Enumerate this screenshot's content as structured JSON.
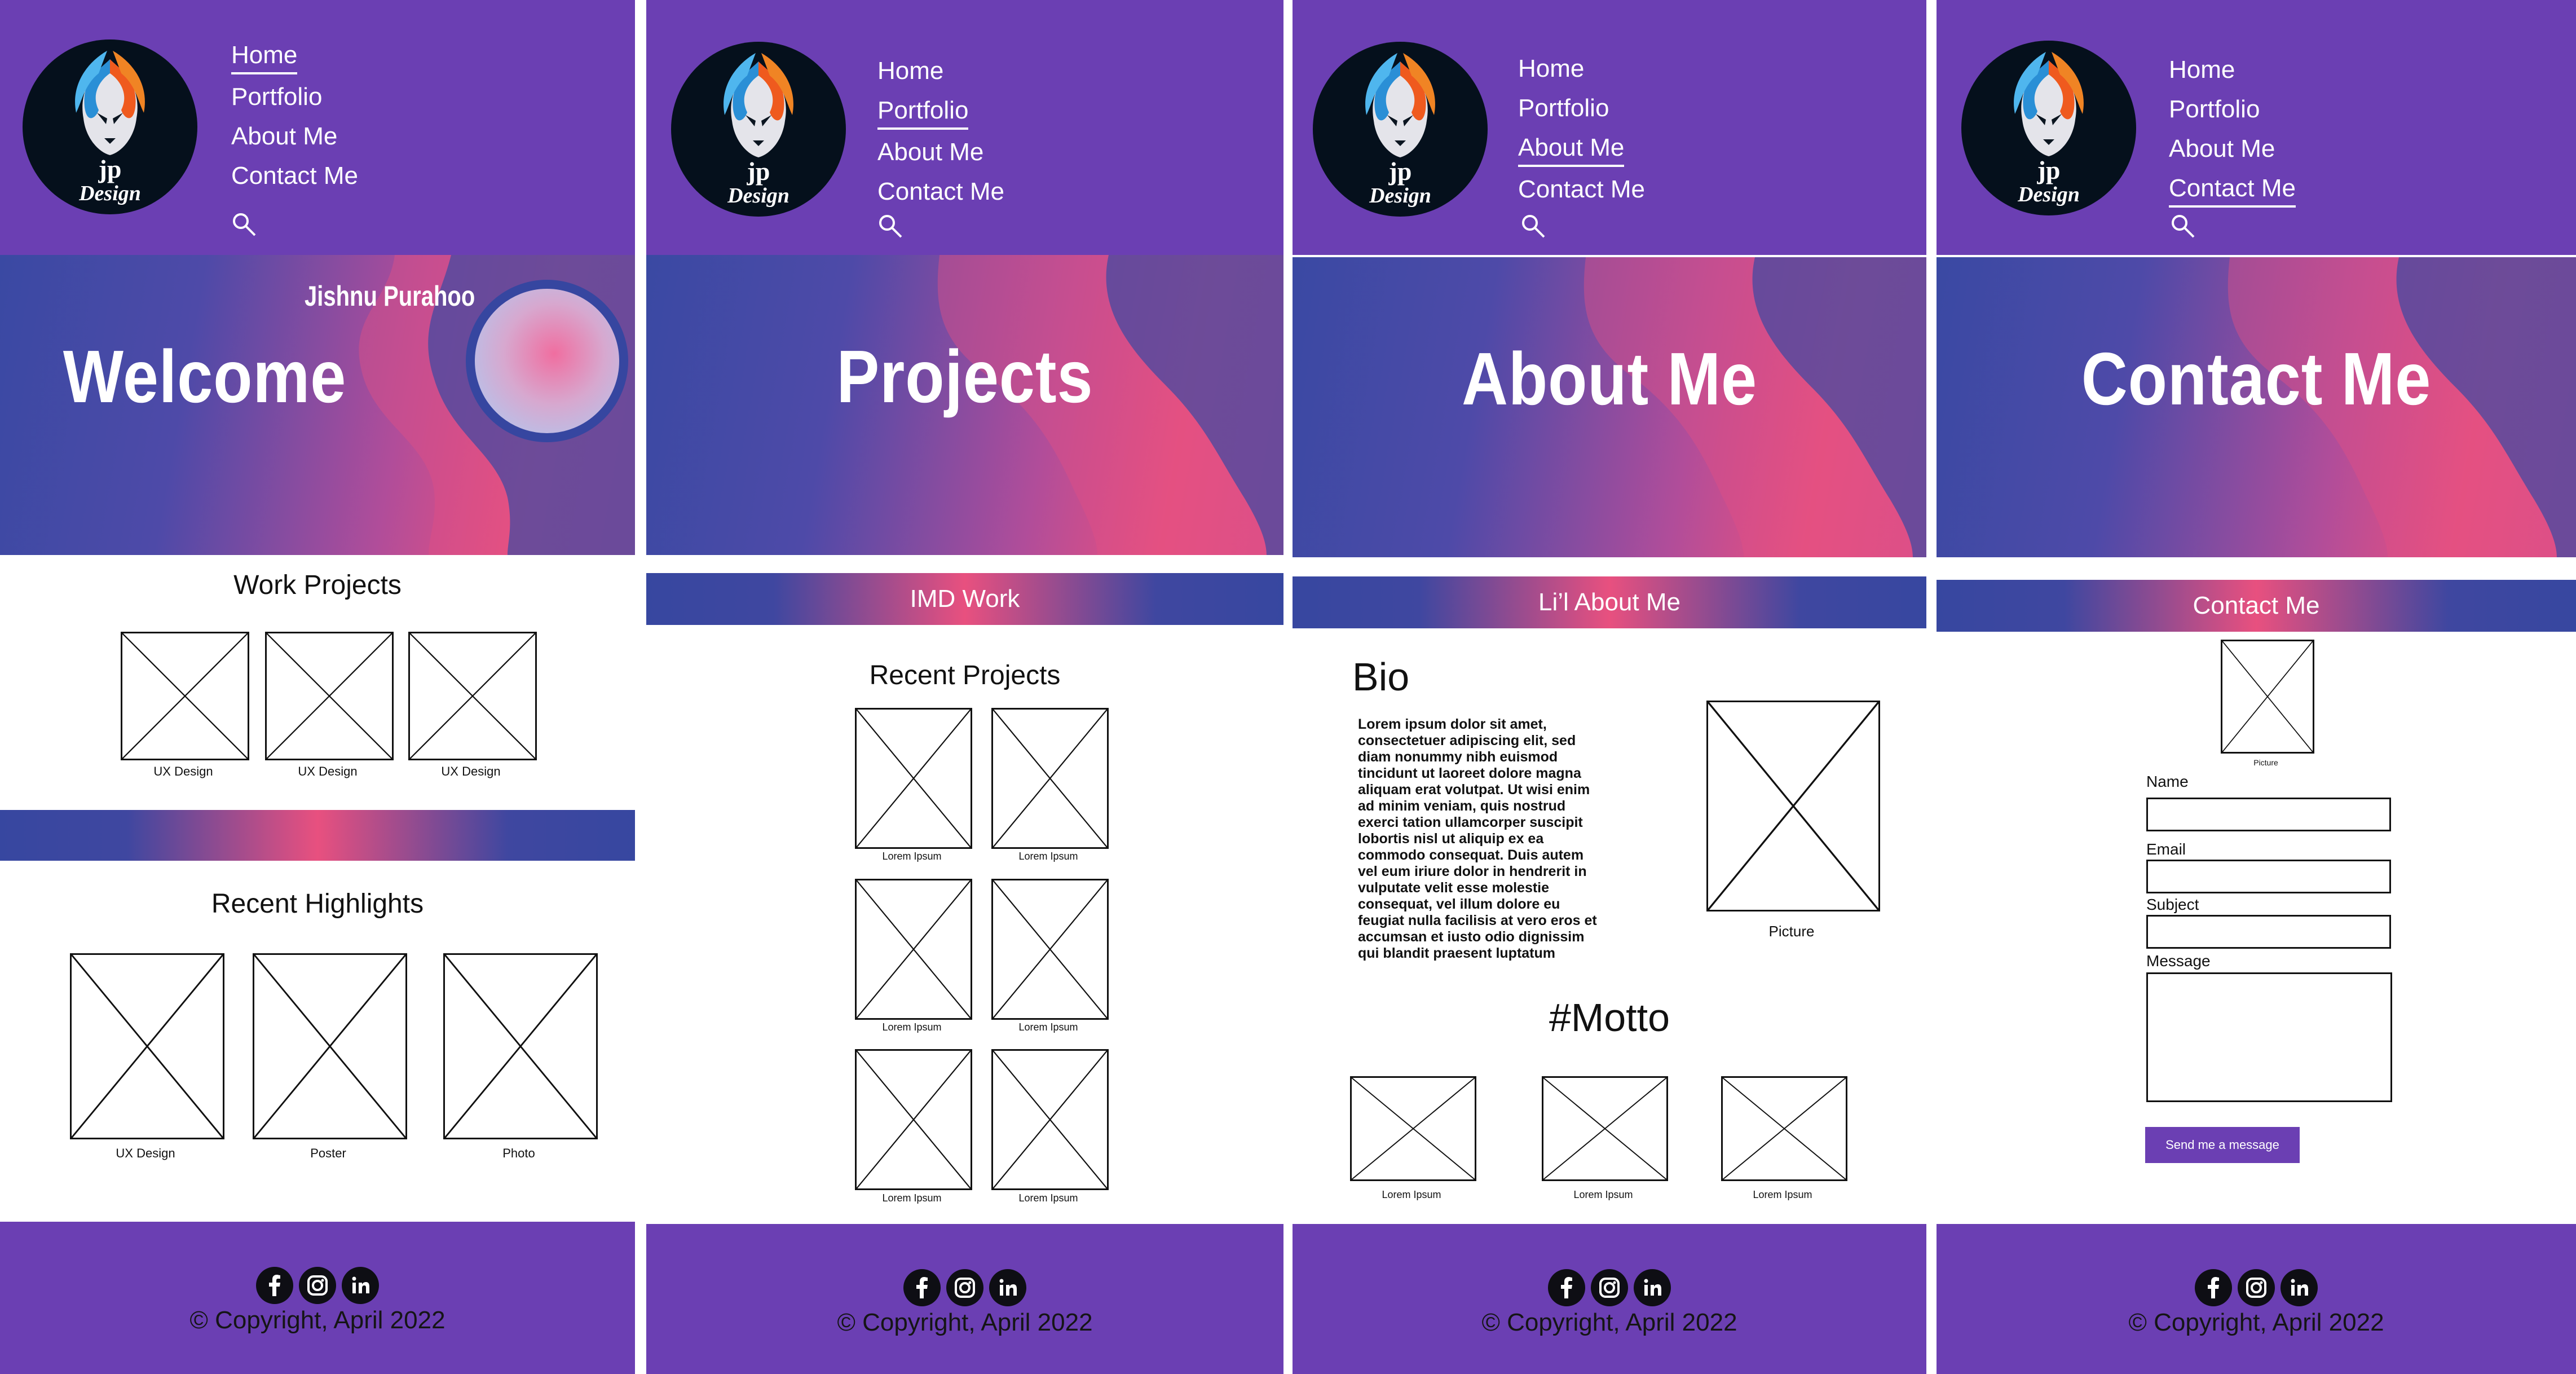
{
  "nav": {
    "items": [
      "Home",
      "Portfolio",
      "About Me",
      "Contact Me"
    ]
  },
  "colors": {
    "header": "#6b3fb3",
    "banner_blue": "#3a49a3",
    "banner_pink": "#e8507f",
    "footer": "#6b3fb3"
  },
  "icons": [
    "search-icon",
    "facebook-icon",
    "instagram-icon",
    "linkedin-icon",
    "jp-design-logo"
  ],
  "pages": [
    {
      "active_nav": "Home",
      "banner_title": "Welcome",
      "banner_subtitle": "Jishnu Purahoo",
      "work_heading": "Work Projects",
      "work_items": [
        "UX Design",
        "UX Design",
        "UX Design"
      ],
      "highlights_heading": "Recent Highlights",
      "highlight_items": [
        "UX Design",
        "Poster",
        "Photo"
      ]
    },
    {
      "active_nav": "Portfolio",
      "banner_title": "Projects",
      "section_bar": "IMD Work",
      "recent_heading": "Recent Projects",
      "project_items": [
        "Lorem Ipsum",
        "Lorem Ipsum",
        "Lorem Ipsum",
        "Lorem Ipsum",
        "Lorem Ipsum",
        "Lorem Ipsum"
      ]
    },
    {
      "active_nav": "About Me",
      "banner_title": "About Me",
      "section_bar": "Li’l About Me",
      "bio_title": "Bio",
      "bio_text": "Lorem ipsum dolor sit amet, consectetuer adipiscing elit, sed diam nonummy nibh euismod tincidunt ut laoreet dolore magna aliquam erat volutpat. Ut wisi enim ad minim veniam, quis nostrud exerci tation ullamcorper suscipit lobortis nisl ut aliquip ex ea commodo consequat. Duis autem vel eum iriure dolor in hendrerit in vulputate velit esse molestie consequat, vel illum dolore eu feugiat nulla facilisis at vero eros et accumsan et iusto odio dignissim qui blandit praesent luptatum",
      "picture_caption": "Picture",
      "motto_heading": "#Motto",
      "motto_items": [
        "Lorem Ipsum",
        "Lorem Ipsum",
        "Lorem Ipsum"
      ]
    },
    {
      "active_nav": "Contact Me",
      "banner_title": "Contact Me",
      "section_bar": "Contact Me",
      "picture_caption": "Picture",
      "labels": {
        "name": "Name",
        "email": "Email",
        "subject": "Subject",
        "message": "Message"
      },
      "send_label": "Send me a message"
    }
  ],
  "footer": {
    "copyright": "© Copyright, April 2022"
  }
}
